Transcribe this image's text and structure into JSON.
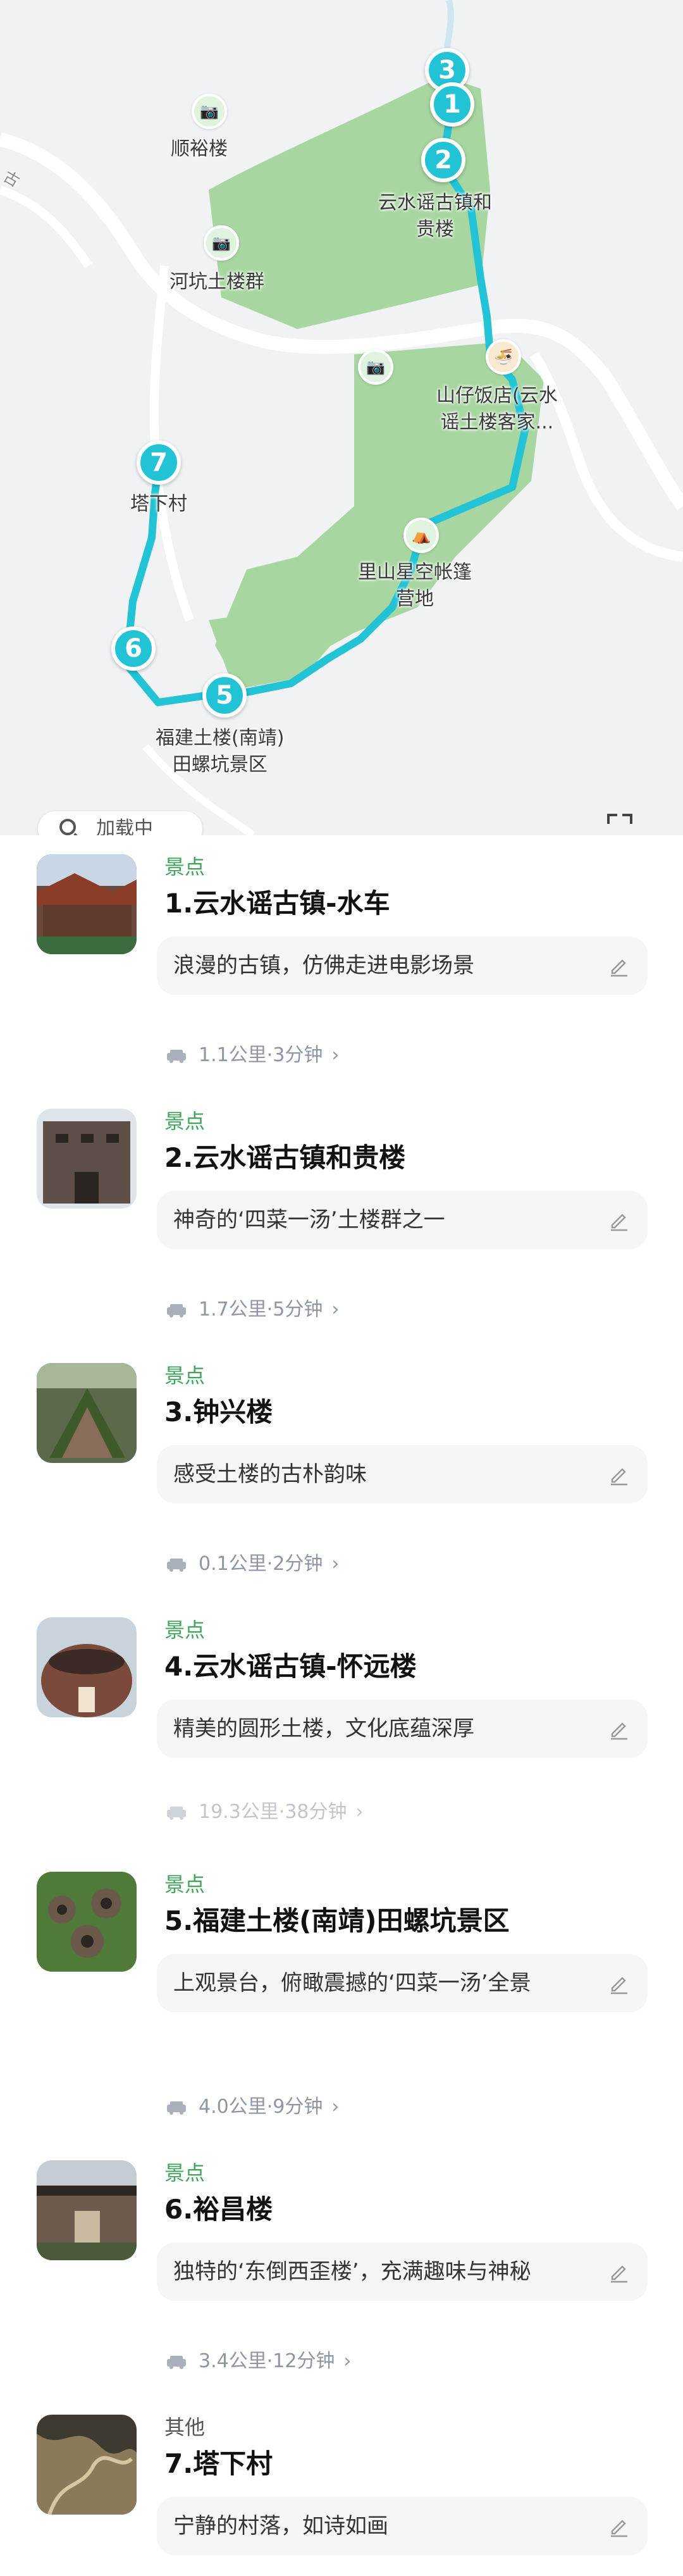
{
  "map": {
    "poi_labels": [
      "顺裕楼",
      "河坑土楼群",
      "云水谣古镇和\n贵楼",
      "山仔饭店(云水\n谣土楼客家...",
      "里山星空帐篷\n营地",
      "塔下村",
      "福建土楼(南靖)\n田螺坑景区"
    ],
    "stop_markers": [
      "3",
      "1",
      "2",
      "7",
      "6",
      "5"
    ],
    "loading_label": "加载中",
    "road_label": "古",
    "colors": {
      "route": "#23c3d6",
      "park": "#a8d6a0",
      "road": "#ffffff",
      "land": "#f1f2f4"
    }
  },
  "stops": [
    {
      "type": "景点",
      "title": "1.云水谣古镇-水车",
      "note": "浪漫的古镇，仿佛走进电影场景",
      "travel": "1.1公里·3分钟"
    },
    {
      "type": "景点",
      "title": "2.云水谣古镇和贵楼",
      "note": "神奇的‘四菜一汤’土楼群之一",
      "travel": "1.7公里·5分钟"
    },
    {
      "type": "景点",
      "title": "3.钟兴楼",
      "note": "感受土楼的古朴韵味",
      "travel": "0.1公里·2分钟"
    },
    {
      "type": "景点",
      "title": "4.云水谣古镇-怀远楼",
      "note": "精美的圆形土楼，文化底蕴深厚",
      "travel": "19.3公里·38分钟"
    },
    {
      "type": "景点",
      "title": "5.福建土楼(南靖)田螺坑景区",
      "note": "上观景台，俯瞰震撼的‘四菜一汤’全景",
      "travel": "4.0公里·9分钟"
    },
    {
      "type": "景点",
      "title": "6.裕昌楼",
      "note": "独特的‘东倒西歪楼’，充满趣味与神秘",
      "travel": "3.4公里·12分钟"
    },
    {
      "type": "其他",
      "title": "7.塔下村",
      "note": "宁静的村落，如诗如画",
      "travel": ""
    }
  ],
  "icons": {
    "edit": "pencil-edit-icon",
    "car": "car-icon",
    "chevron": "chevron-right-icon",
    "search": "search-icon",
    "fullscreen": "fullscreen-icon"
  }
}
